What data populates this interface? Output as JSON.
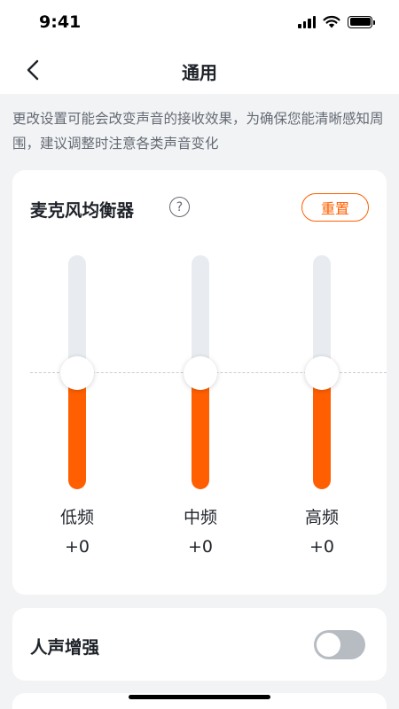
{
  "status_bar": {
    "time": "9:41"
  },
  "nav": {
    "title": "通用"
  },
  "hint": "更改设置可能会改变声音的接收效果，为确保您能清晰感知周围，建议调整时注意各类声音变化",
  "equalizer": {
    "title": "麦克风均衡器",
    "reset_label": "重置",
    "bands": [
      {
        "label": "低频",
        "value": "+0",
        "level_fraction": 0.5
      },
      {
        "label": "中频",
        "value": "+0",
        "level_fraction": 0.5
      },
      {
        "label": "高频",
        "value": "+0",
        "level_fraction": 0.5
      }
    ]
  },
  "voice_enhance": {
    "label": "人声增强",
    "enabled": false
  },
  "colors": {
    "accent": "#FF5F00",
    "background": "#F2F3F5",
    "card": "#FFFFFF",
    "track": "#E8ECF0",
    "toggle_off": "#B7BCC3"
  },
  "icons": [
    "back-chevron-icon",
    "help-circle-icon",
    "signal-icon",
    "wifi-icon",
    "battery-icon"
  ]
}
